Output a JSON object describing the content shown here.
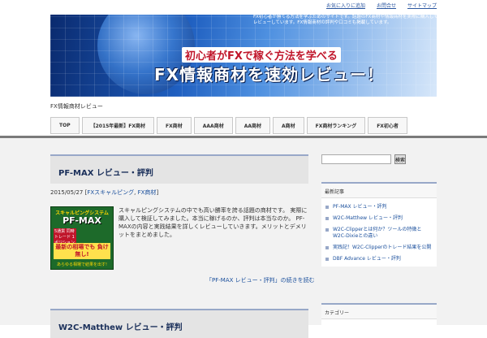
{
  "top_links": [
    "お気に入りに追加",
    "お問合せ",
    "サイトマップ"
  ],
  "banner": {
    "description": "FX初心者が勝てる方法を学ぶためのサイトです。話題のFX商材や情報商材を実際に購入してレビューしています。FX情報商材の評判や口コミも掲載しています。",
    "subtitle": "初心者がFXで稼ぐ方法を学べる",
    "title": "FX情報商材を速効レビュー！"
  },
  "tagline": "FX情報商材レビュー",
  "nav": [
    "TOP",
    "【2015年最新】FX商材",
    "FX商材",
    "AAA商材",
    "AA商材",
    "A商材",
    "FX商材ランキング",
    "FX初心者"
  ],
  "posts": [
    {
      "title": "PF-MAX レビュー・評判",
      "date": "2015/05/27",
      "categories": [
        "FXスキャルピング",
        "FX商材"
      ],
      "thumb": {
        "label1": "スキャルピングシステム",
        "label2": "PF-MAX",
        "label3": "5通貨 同時トレード 1ポジション 利益確定!",
        "label4": "最新の相場でも 負け無し!",
        "label5": "あらゆる相場で結果を出す!"
      },
      "excerpt": "スキャルピングシステムの中でも高い勝率を誇る話題の商材です。 実際に購入して検証してみました。本当に稼げるのか、評判は本当なのか。 PF-MAXの内容と実践結果を詳しくレビューしていきます。メリットとデメリットをまとめました。",
      "readmore": "「PF-MAX レビュー・評判」の続きを読む"
    },
    {
      "title": "W2C-Matthew レビュー・評判"
    }
  ],
  "sidebar": {
    "search_button": "検索",
    "widget1_title": "最新記事",
    "recent": [
      "PF-MAX レビュー・評判",
      "W2C-Matthew レビュー・評判",
      "W2C-Clipperとは何か？ツールの特徴とW2C-Dixieとの違い",
      "実践記！W2C-Clipperのトレード結果を公開",
      "DBF Advance レビュー・評判"
    ],
    "widget2_title": "カテゴリー"
  }
}
